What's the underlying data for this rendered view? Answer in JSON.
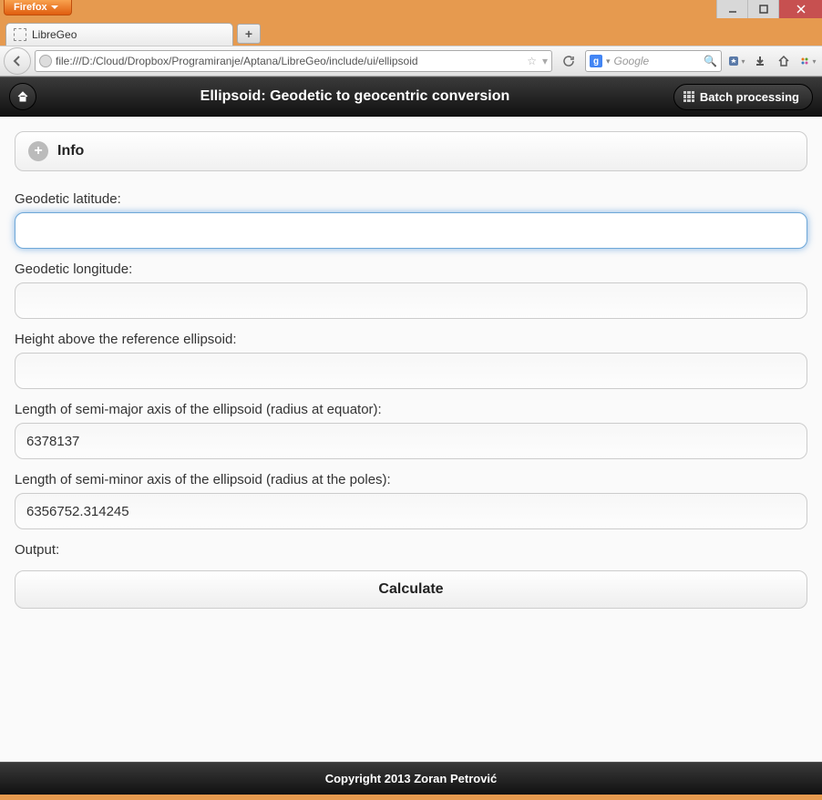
{
  "browser": {
    "menu_label": "Firefox",
    "tab_title": "LibreGeo",
    "url": "file:///D:/Cloud/Dropbox/Programiranje/Aptana/LibreGeo/include/ui/ellipsoid",
    "search_placeholder": "Google"
  },
  "header": {
    "title": "Ellipsoid: Geodetic to geocentric conversion",
    "batch_label": "Batch processing"
  },
  "collapsible": {
    "info_label": "Info"
  },
  "form": {
    "lat_label": "Geodetic latitude:",
    "lat_value": "",
    "lon_label": "Geodetic longitude:",
    "lon_value": "",
    "height_label": "Height above the reference ellipsoid:",
    "height_value": "",
    "semimajor_label": "Length of semi-major axis of the ellipsoid (radius at equator):",
    "semimajor_value": "6378137",
    "semiminor_label": "Length of semi-minor axis of the ellipsoid (radius at the poles):",
    "semiminor_value": "6356752.314245",
    "output_label": "Output:",
    "calculate_label": "Calculate"
  },
  "footer": {
    "copyright": "Copyright 2013 Zoran Petrović"
  }
}
